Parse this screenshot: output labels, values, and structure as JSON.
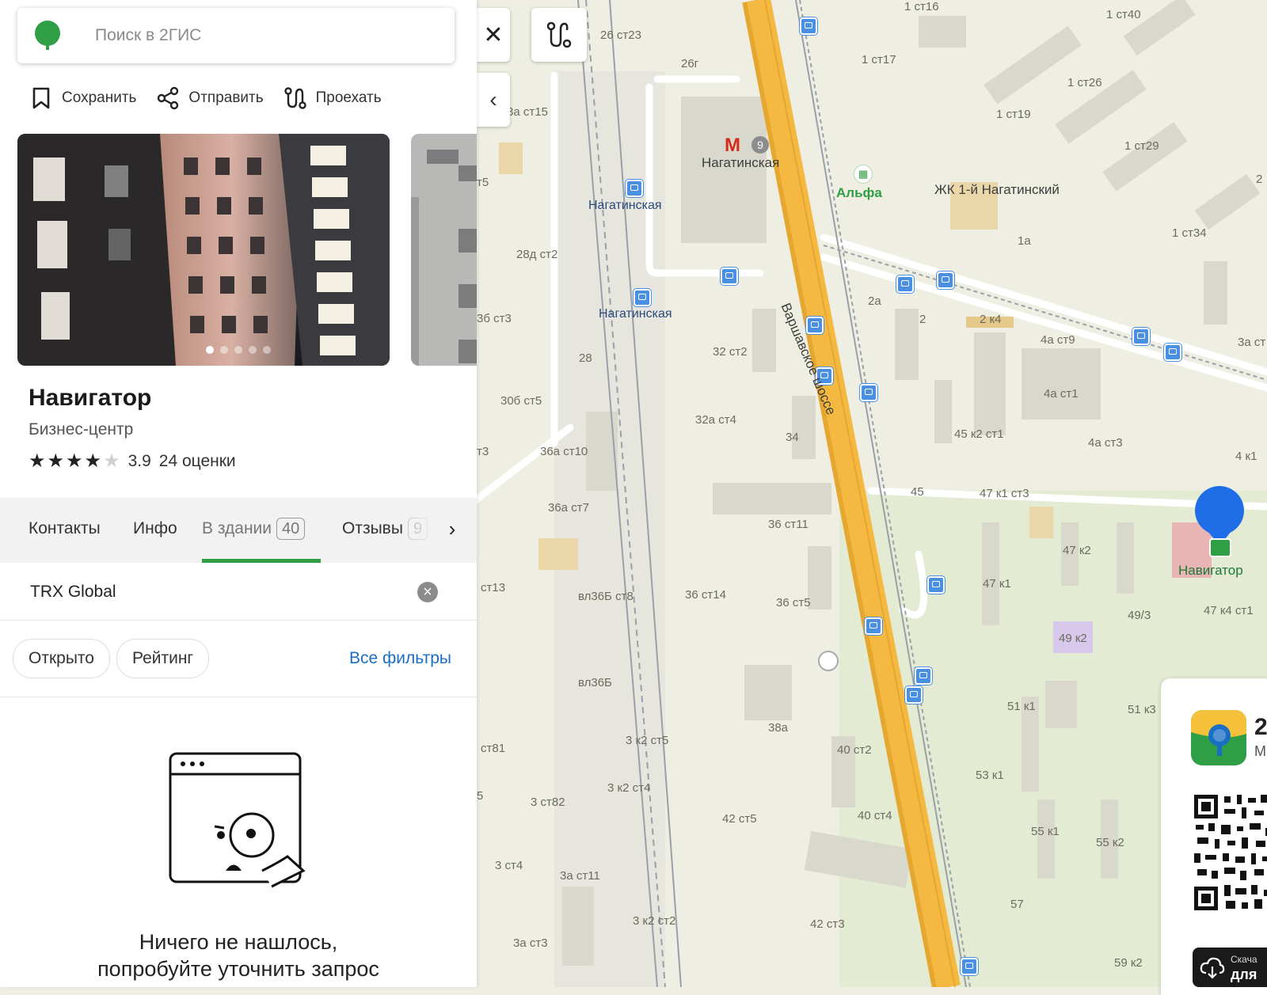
{
  "search": {
    "placeholder": "Поиск в 2ГИС"
  },
  "actions": {
    "save": "Сохранить",
    "share": "Отправить",
    "route": "Проехать"
  },
  "gallery": {
    "photo_count": 5,
    "active_index": 0
  },
  "place": {
    "title": "Навигатор",
    "category": "Бизнес-центр",
    "rating": "3.9",
    "rating_stars": 4,
    "reviews": "24 оценки"
  },
  "tabs": {
    "contacts": "Контакты",
    "info": "Инфо",
    "in_building": "В здании",
    "in_building_count": "40",
    "reviews": "Отзывы",
    "reviews_count": "9"
  },
  "filter": {
    "query": "TRX Global"
  },
  "chips": {
    "open": "Открыто",
    "rating": "Рейтинг",
    "all_filters": "Все фильтры"
  },
  "empty": {
    "line1": "Ничего не нашлось,",
    "line2": "попробуйте уточнить запрос"
  },
  "map": {
    "metro_line": "9",
    "labels": {
      "metro_station": "Нагатинская",
      "station1": "Нагатинская",
      "station2": "Нагатинская",
      "road": "Варшавское шоссе",
      "poi_alfa": "Альфа",
      "complex": "ЖК 1-й Нагатинский",
      "target": "Навигатор",
      "b1": "26 ст23",
      "b2": "26г",
      "b3": "1 ст16",
      "b4": "1 ст17",
      "b5": "1 ст40",
      "b6": "1 ст26",
      "b7": "1 ст19",
      "b8": "1 ст29",
      "b9": "1 ст34",
      "b10": "8а ст15",
      "b11": "т5",
      "b12": "28д ст2",
      "b13": "3б ст3",
      "b14": "28",
      "b15": "32 ст2",
      "b16": "2а",
      "b17": "2",
      "b18": "2 к4",
      "b19": "4а ст9",
      "b20": "3а ст",
      "b21": "4а ст1",
      "b22": "30б ст5",
      "b23": "32а ст4",
      "b24": "34",
      "b25": "45 к2 ст1",
      "b26": "4а ст3",
      "b27": "4 к1",
      "b28": "т3",
      "b29": "36а ст10",
      "b30": "45",
      "b31": "47 к1 ст3",
      "b32": "36а ст7",
      "b33": "36 ст11",
      "b34": "47 к2",
      "b35": "ст13",
      "b36": "вл36Б ст8",
      "b37": "36 ст14",
      "b38": "36 ст5",
      "b39": "47 к1",
      "b40": "49/3",
      "b41": "47 к4 ст1",
      "b42": "49 к2",
      "b43": "вл36Б",
      "b44": "51 к1",
      "b45": "51 к3",
      "b46": "ст81",
      "b47": "3 к2 ст5",
      "b48": "38а",
      "b49": "40 ст2",
      "b50": "53 к1",
      "b51": "5",
      "b52": "3 ст82",
      "b53": "3 к2 ст4",
      "b54": "42 ст5",
      "b55": "40 ст4",
      "b56": "55 к1",
      "b57": "55 к2",
      "b58": "3 ст4",
      "b59": "3а ст11",
      "b60": "3 к2 ст2",
      "b61": "42 ст3",
      "b62": "57",
      "b63": "3а ст3",
      "b64": "59 к2",
      "b65": "2",
      "b66": "1а",
      "b67": "1"
    },
    "app_card": {
      "letter": "2",
      "letter2": "M",
      "dl_line1": "Скача",
      "dl_line2": "для"
    }
  }
}
